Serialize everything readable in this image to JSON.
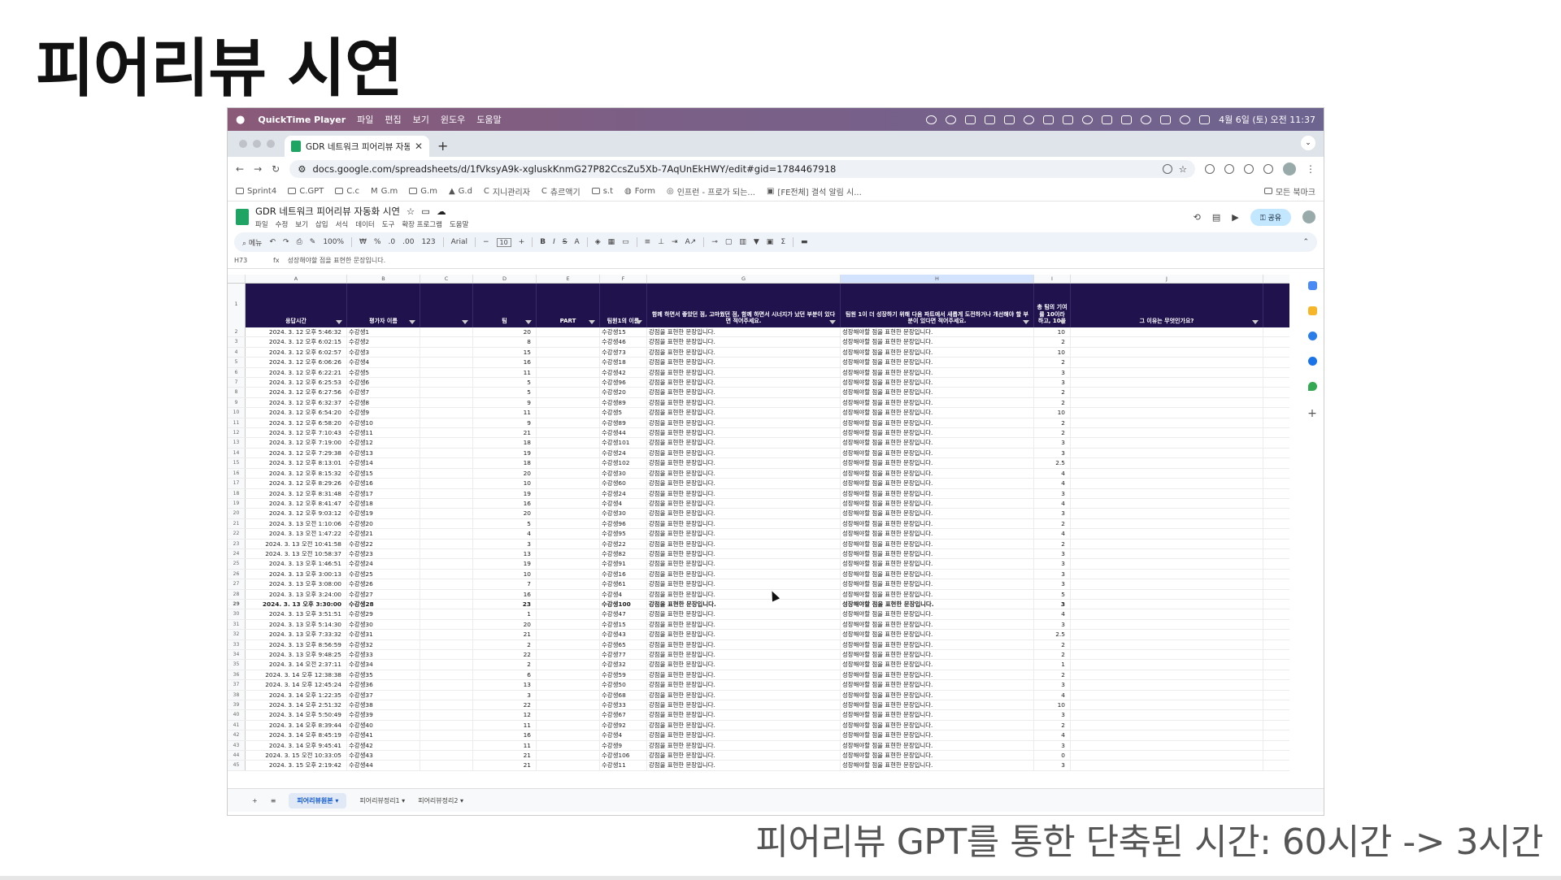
{
  "slide": {
    "title": "피어리뷰 시연",
    "footer": "피어리뷰 GPT를 통한 단축된 시간: 60시간 -> 3시간"
  },
  "macos_menubar": {
    "app": "QuickTime Player",
    "menus": [
      "파일",
      "편집",
      "보기",
      "윈도우",
      "도움말"
    ],
    "clock": "4월 6일 (토) 오전 11:37"
  },
  "browser": {
    "tab_title": "GDR 네트워크 피어리뷰 자동화 시",
    "url": "docs.google.com/spreadsheets/d/1fVksyA9k-xgluskKnmG27P82CcsZu5Xb-7AqUnEkHWY/edit#gid=1784467918",
    "bookmarks": [
      "Sprint4",
      "C.GPT",
      "C.c",
      "G.m",
      "G.m",
      "G.d",
      "지니관리자",
      "츄르액기",
      "s.t",
      "Form",
      "인프런 - 프로가 되는...",
      "[FE전체] 결석 알림 시..."
    ],
    "all_bookmarks": "모든 북마크"
  },
  "doc": {
    "title": "GDR 네트워크 피어리뷰 자동화 시연",
    "menus": [
      "파일",
      "수정",
      "보기",
      "삽입",
      "서식",
      "데이터",
      "도구",
      "확장 프로그램",
      "도움말"
    ],
    "share_label": "공유"
  },
  "toolbar": {
    "search": "메뉴",
    "zoom": "100%",
    "font": "Arial",
    "font_size": "10"
  },
  "formula_bar": {
    "cell_ref": "H73",
    "content": "성장해야할 점을 표현한 문장입니다."
  },
  "columns": [
    "A",
    "B",
    "C",
    "D",
    "E",
    "F",
    "G",
    "H",
    "I",
    "J"
  ],
  "header": {
    "a": "응답시간",
    "b": "평가자 이름",
    "c": "",
    "d": "팀",
    "e": "PART",
    "f": "팀원1의 이름",
    "g": "함께 하면서 좋았던 점, 고마웠던 점, 함께 하면서 시너지가 났던 부분이 있다면 적어주세요.",
    "h": "팀원 1이 더 성장하기 위해 다음 파트에서 새롭게 도전하거나 개선해야 할 부분이 있다면 적어주세요.",
    "i": "총 팀의 기여를 10이라 하고, 10을",
    "j": "그 이유는 무엇인가요?"
  },
  "good_text": "강점을 표현한 문장입니다.",
  "grow_text": "성장해야할 점을 표현한 문장입니다.",
  "rows": [
    [
      "2024. 3. 12 오후 5:46:32",
      "수강생1",
      "20",
      "수강생15",
      "10"
    ],
    [
      "2024. 3. 12 오후 6:02:15",
      "수강생2",
      "8",
      "수강생46",
      "2"
    ],
    [
      "2024. 3. 12 오후 6:02:57",
      "수강생3",
      "15",
      "수강생73",
      "10"
    ],
    [
      "2024. 3. 12 오후 6:06:26",
      "수강생4",
      "16",
      "수강생18",
      "2"
    ],
    [
      "2024. 3. 12 오후 6:22:21",
      "수강생5",
      "11",
      "수강생42",
      "3"
    ],
    [
      "2024. 3. 12 오후 6:25:53",
      "수강생6",
      "5",
      "수강생96",
      "3"
    ],
    [
      "2024. 3. 12 오후 6:27:56",
      "수강생7",
      "5",
      "수강생20",
      "2"
    ],
    [
      "2024. 3. 12 오후 6:32:37",
      "수강생8",
      "9",
      "수강생89",
      "2"
    ],
    [
      "2024. 3. 12 오후 6:54:20",
      "수강생9",
      "11",
      "수강생5",
      "10"
    ],
    [
      "2024. 3. 12 오후 6:58:20",
      "수강생10",
      "9",
      "수강생89",
      "2"
    ],
    [
      "2024. 3. 12 오후 7:10:43",
      "수강생11",
      "21",
      "수강생44",
      "2"
    ],
    [
      "2024. 3. 12 오후 7:19:00",
      "수강생12",
      "18",
      "수강생101",
      "3"
    ],
    [
      "2024. 3. 12 오후 7:29:38",
      "수강생13",
      "19",
      "수강생24",
      "3"
    ],
    [
      "2024. 3. 12 오후 8:13:01",
      "수강생14",
      "18",
      "수강생102",
      "2.5"
    ],
    [
      "2024. 3. 12 오후 8:15:32",
      "수강생15",
      "20",
      "수강생30",
      "4"
    ],
    [
      "2024. 3. 12 오후 8:29:26",
      "수강생16",
      "10",
      "수강생60",
      "4"
    ],
    [
      "2024. 3. 12 오후 8:31:48",
      "수강생17",
      "19",
      "수강생24",
      "3"
    ],
    [
      "2024. 3. 12 오후 8:41:47",
      "수강생18",
      "16",
      "수강생4",
      "4"
    ],
    [
      "2024. 3. 12 오후 9:03:12",
      "수강생19",
      "20",
      "수강생30",
      "3"
    ],
    [
      "2024. 3. 13 오전 1:10:06",
      "수강생20",
      "5",
      "수강생96",
      "2"
    ],
    [
      "2024. 3. 13 오전 1:47:22",
      "수강생21",
      "4",
      "수강생95",
      "4"
    ],
    [
      "2024. 3. 13 오전 10:41:58",
      "수강생22",
      "3",
      "수강생22",
      "2"
    ],
    [
      "2024. 3. 13 오전 10:58:37",
      "수강생23",
      "13",
      "수강생82",
      "3"
    ],
    [
      "2024. 3. 13 오후 1:46:51",
      "수강생24",
      "19",
      "수강생91",
      "3"
    ],
    [
      "2024. 3. 13 오후 3:00:13",
      "수강생25",
      "10",
      "수강생16",
      "3"
    ],
    [
      "2024. 3. 13 오후 3:08:00",
      "수강생26",
      "7",
      "수강생61",
      "3"
    ],
    [
      "2024. 3. 13 오후 3:24:00",
      "수강생27",
      "16",
      "수강생4",
      "5"
    ],
    [
      "2024. 3. 13 오후 3:30:00",
      "수강생28",
      "23",
      "수강생100",
      "3"
    ],
    [
      "2024. 3. 13 오후 3:51:51",
      "수강생29",
      "1",
      "수강생47",
      "4"
    ],
    [
      "2024. 3. 13 오후 5:14:30",
      "수강생30",
      "20",
      "수강생15",
      "3"
    ],
    [
      "2024. 3. 13 오후 7:33:32",
      "수강생31",
      "21",
      "수강생43",
      "2.5"
    ],
    [
      "2024. 3. 13 오후 8:56:59",
      "수강생32",
      "2",
      "수강생65",
      "2"
    ],
    [
      "2024. 3. 13 오후 9:48:25",
      "수강생33",
      "22",
      "수강생77",
      "2"
    ],
    [
      "2024. 3. 14 오전 2:37:11",
      "수강생34",
      "2",
      "수강생32",
      "1"
    ],
    [
      "2024. 3. 14 오후 12:38:38",
      "수강생35",
      "6",
      "수강생59",
      "2"
    ],
    [
      "2024. 3. 14 오후 12:45:24",
      "수강생36",
      "13",
      "수강생50",
      "3"
    ],
    [
      "2024. 3. 14 오후 1:22:35",
      "수강생37",
      "3",
      "수강생68",
      "4"
    ],
    [
      "2024. 3. 14 오후 2:51:32",
      "수강생38",
      "22",
      "수강생33",
      "10"
    ],
    [
      "2024. 3. 14 오후 5:50:49",
      "수강생39",
      "12",
      "수강생67",
      "3"
    ],
    [
      "2024. 3. 14 오후 8:39:44",
      "수강생40",
      "11",
      "수강생92",
      "2"
    ],
    [
      "2024. 3. 14 오후 8:45:19",
      "수강생41",
      "16",
      "수강생4",
      "4"
    ],
    [
      "2024. 3. 14 오후 9:45:41",
      "수강생42",
      "11",
      "수강생9",
      "3"
    ],
    [
      "2024. 3. 15 오전 10:33:05",
      "수강생43",
      "21",
      "수강생106",
      "0"
    ],
    [
      "2024. 3. 15 오후 2:19:42",
      "수강생44",
      "21",
      "수강생11",
      "3"
    ]
  ],
  "sheet_tabs": [
    "피어리뷰원본",
    "피어리뷰정리1",
    "피어리뷰정리2"
  ],
  "colors": {
    "header_bg": "#20124d",
    "selected_column": "#d3e3fd",
    "sheets_green": "#1fa463"
  }
}
